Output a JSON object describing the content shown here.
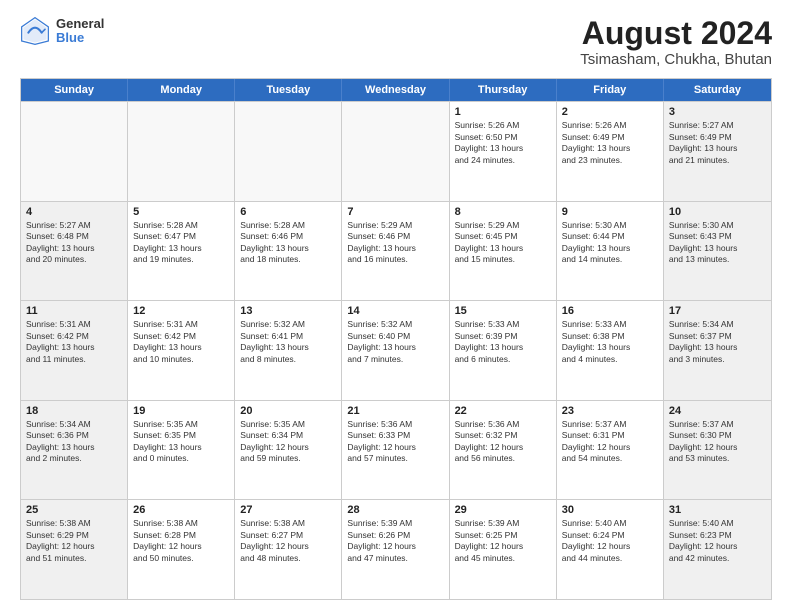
{
  "logo": {
    "general": "General",
    "blue": "Blue"
  },
  "title": "August 2024",
  "subtitle": "Tsimasham, Chukha, Bhutan",
  "days_of_week": [
    "Sunday",
    "Monday",
    "Tuesday",
    "Wednesday",
    "Thursday",
    "Friday",
    "Saturday"
  ],
  "weeks": [
    [
      {
        "day": "",
        "content": ""
      },
      {
        "day": "",
        "content": ""
      },
      {
        "day": "",
        "content": ""
      },
      {
        "day": "",
        "content": ""
      },
      {
        "day": "1",
        "content": "Sunrise: 5:26 AM\nSunset: 6:50 PM\nDaylight: 13 hours\nand 24 minutes."
      },
      {
        "day": "2",
        "content": "Sunrise: 5:26 AM\nSunset: 6:49 PM\nDaylight: 13 hours\nand 23 minutes."
      },
      {
        "day": "3",
        "content": "Sunrise: 5:27 AM\nSunset: 6:49 PM\nDaylight: 13 hours\nand 21 minutes."
      }
    ],
    [
      {
        "day": "4",
        "content": "Sunrise: 5:27 AM\nSunset: 6:48 PM\nDaylight: 13 hours\nand 20 minutes."
      },
      {
        "day": "5",
        "content": "Sunrise: 5:28 AM\nSunset: 6:47 PM\nDaylight: 13 hours\nand 19 minutes."
      },
      {
        "day": "6",
        "content": "Sunrise: 5:28 AM\nSunset: 6:46 PM\nDaylight: 13 hours\nand 18 minutes."
      },
      {
        "day": "7",
        "content": "Sunrise: 5:29 AM\nSunset: 6:46 PM\nDaylight: 13 hours\nand 16 minutes."
      },
      {
        "day": "8",
        "content": "Sunrise: 5:29 AM\nSunset: 6:45 PM\nDaylight: 13 hours\nand 15 minutes."
      },
      {
        "day": "9",
        "content": "Sunrise: 5:30 AM\nSunset: 6:44 PM\nDaylight: 13 hours\nand 14 minutes."
      },
      {
        "day": "10",
        "content": "Sunrise: 5:30 AM\nSunset: 6:43 PM\nDaylight: 13 hours\nand 13 minutes."
      }
    ],
    [
      {
        "day": "11",
        "content": "Sunrise: 5:31 AM\nSunset: 6:42 PM\nDaylight: 13 hours\nand 11 minutes."
      },
      {
        "day": "12",
        "content": "Sunrise: 5:31 AM\nSunset: 6:42 PM\nDaylight: 13 hours\nand 10 minutes."
      },
      {
        "day": "13",
        "content": "Sunrise: 5:32 AM\nSunset: 6:41 PM\nDaylight: 13 hours\nand 8 minutes."
      },
      {
        "day": "14",
        "content": "Sunrise: 5:32 AM\nSunset: 6:40 PM\nDaylight: 13 hours\nand 7 minutes."
      },
      {
        "day": "15",
        "content": "Sunrise: 5:33 AM\nSunset: 6:39 PM\nDaylight: 13 hours\nand 6 minutes."
      },
      {
        "day": "16",
        "content": "Sunrise: 5:33 AM\nSunset: 6:38 PM\nDaylight: 13 hours\nand 4 minutes."
      },
      {
        "day": "17",
        "content": "Sunrise: 5:34 AM\nSunset: 6:37 PM\nDaylight: 13 hours\nand 3 minutes."
      }
    ],
    [
      {
        "day": "18",
        "content": "Sunrise: 5:34 AM\nSunset: 6:36 PM\nDaylight: 13 hours\nand 2 minutes."
      },
      {
        "day": "19",
        "content": "Sunrise: 5:35 AM\nSunset: 6:35 PM\nDaylight: 13 hours\nand 0 minutes."
      },
      {
        "day": "20",
        "content": "Sunrise: 5:35 AM\nSunset: 6:34 PM\nDaylight: 12 hours\nand 59 minutes."
      },
      {
        "day": "21",
        "content": "Sunrise: 5:36 AM\nSunset: 6:33 PM\nDaylight: 12 hours\nand 57 minutes."
      },
      {
        "day": "22",
        "content": "Sunrise: 5:36 AM\nSunset: 6:32 PM\nDaylight: 12 hours\nand 56 minutes."
      },
      {
        "day": "23",
        "content": "Sunrise: 5:37 AM\nSunset: 6:31 PM\nDaylight: 12 hours\nand 54 minutes."
      },
      {
        "day": "24",
        "content": "Sunrise: 5:37 AM\nSunset: 6:30 PM\nDaylight: 12 hours\nand 53 minutes."
      }
    ],
    [
      {
        "day": "25",
        "content": "Sunrise: 5:38 AM\nSunset: 6:29 PM\nDaylight: 12 hours\nand 51 minutes."
      },
      {
        "day": "26",
        "content": "Sunrise: 5:38 AM\nSunset: 6:28 PM\nDaylight: 12 hours\nand 50 minutes."
      },
      {
        "day": "27",
        "content": "Sunrise: 5:38 AM\nSunset: 6:27 PM\nDaylight: 12 hours\nand 48 minutes."
      },
      {
        "day": "28",
        "content": "Sunrise: 5:39 AM\nSunset: 6:26 PM\nDaylight: 12 hours\nand 47 minutes."
      },
      {
        "day": "29",
        "content": "Sunrise: 5:39 AM\nSunset: 6:25 PM\nDaylight: 12 hours\nand 45 minutes."
      },
      {
        "day": "30",
        "content": "Sunrise: 5:40 AM\nSunset: 6:24 PM\nDaylight: 12 hours\nand 44 minutes."
      },
      {
        "day": "31",
        "content": "Sunrise: 5:40 AM\nSunset: 6:23 PM\nDaylight: 12 hours\nand 42 minutes."
      }
    ]
  ]
}
